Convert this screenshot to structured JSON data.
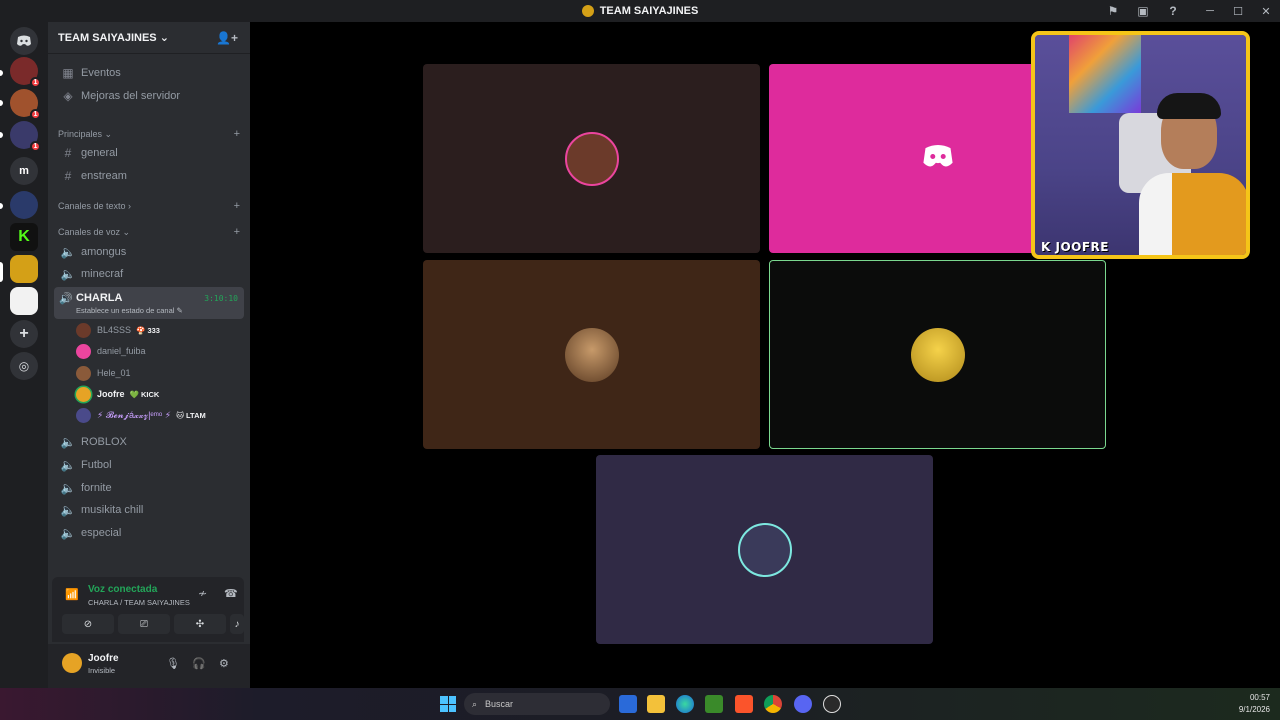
{
  "window": {
    "title": "TEAM SAIYAJINES"
  },
  "server": {
    "name": "TEAM SAIYAJINES",
    "top_items": [
      {
        "icon": "calendar-icon",
        "label": "Eventos"
      },
      {
        "icon": "boost-icon",
        "label": "Mejoras del servidor"
      }
    ],
    "categories": {
      "principales": "Principales",
      "texto": "Canales de texto",
      "voz": "Canales de voz"
    },
    "text_channels": [
      "general",
      "enstream"
    ],
    "voice_channels_top": [
      "amongus",
      "minecraf"
    ],
    "active_channel": {
      "name": "CHARLA",
      "status_hint": "Establece un estado de canal",
      "timer": "3:10:10"
    },
    "members": [
      {
        "name": "BL4SSS",
        "tag": "333",
        "color": "#6b3a2a"
      },
      {
        "name": "daniel_fuiba",
        "tag": "",
        "color": "#eb459e"
      },
      {
        "name": "Hele_01",
        "tag": "",
        "color": "#8a5a3a"
      },
      {
        "name": "Joofre",
        "tag": "KICK",
        "color": "#e6a325"
      },
      {
        "name": "⚡ 𝓑𝓮𝓷𝓳á𝔁𝔁𝔃|ᵉᵐᵒ ⚡",
        "tag": "LTAM",
        "color": "#4a4a8a"
      }
    ],
    "voice_channels_bottom": [
      "ROBLOX",
      "Futbol",
      "fornite",
      "musikita chill",
      "especial"
    ]
  },
  "server_rail": [
    {
      "letter": "",
      "color": "#5865f2",
      "badge": ""
    },
    {
      "letter": "",
      "color": "#7a2a2a",
      "badge": "1"
    },
    {
      "letter": "",
      "color": "#a0522d",
      "badge": "1"
    },
    {
      "letter": "",
      "color": "#3a3a6a",
      "badge": "1"
    },
    {
      "letter": "m",
      "color": "#313338",
      "badge": ""
    },
    {
      "letter": "",
      "color": "#2a3a6a",
      "badge": ""
    },
    {
      "letter": "K",
      "color": "#111111",
      "badge": ""
    },
    {
      "letter": "",
      "color": "#d4a017",
      "badge": ""
    },
    {
      "letter": "",
      "color": "#f2f2f2",
      "badge": ""
    }
  ],
  "voice_panel": {
    "status": "Voz conectada",
    "location": "CHARLA / TEAM SAIYAJINES"
  },
  "user_panel": {
    "name": "Joofre",
    "status": "Invisible"
  },
  "stage": {
    "camera_label": "K JOOFRE",
    "tiles": [
      {
        "bg": "#2b1e1e"
      },
      {
        "bg": "#de2b9c"
      },
      {
        "bg": "#3f2617"
      },
      {
        "bg": "#0b0c0b",
        "speaking": true
      },
      {
        "bg": "#302a45"
      }
    ]
  },
  "taskbar": {
    "search_placeholder": "Buscar",
    "time": "00:57",
    "date": "9/1/2026"
  }
}
